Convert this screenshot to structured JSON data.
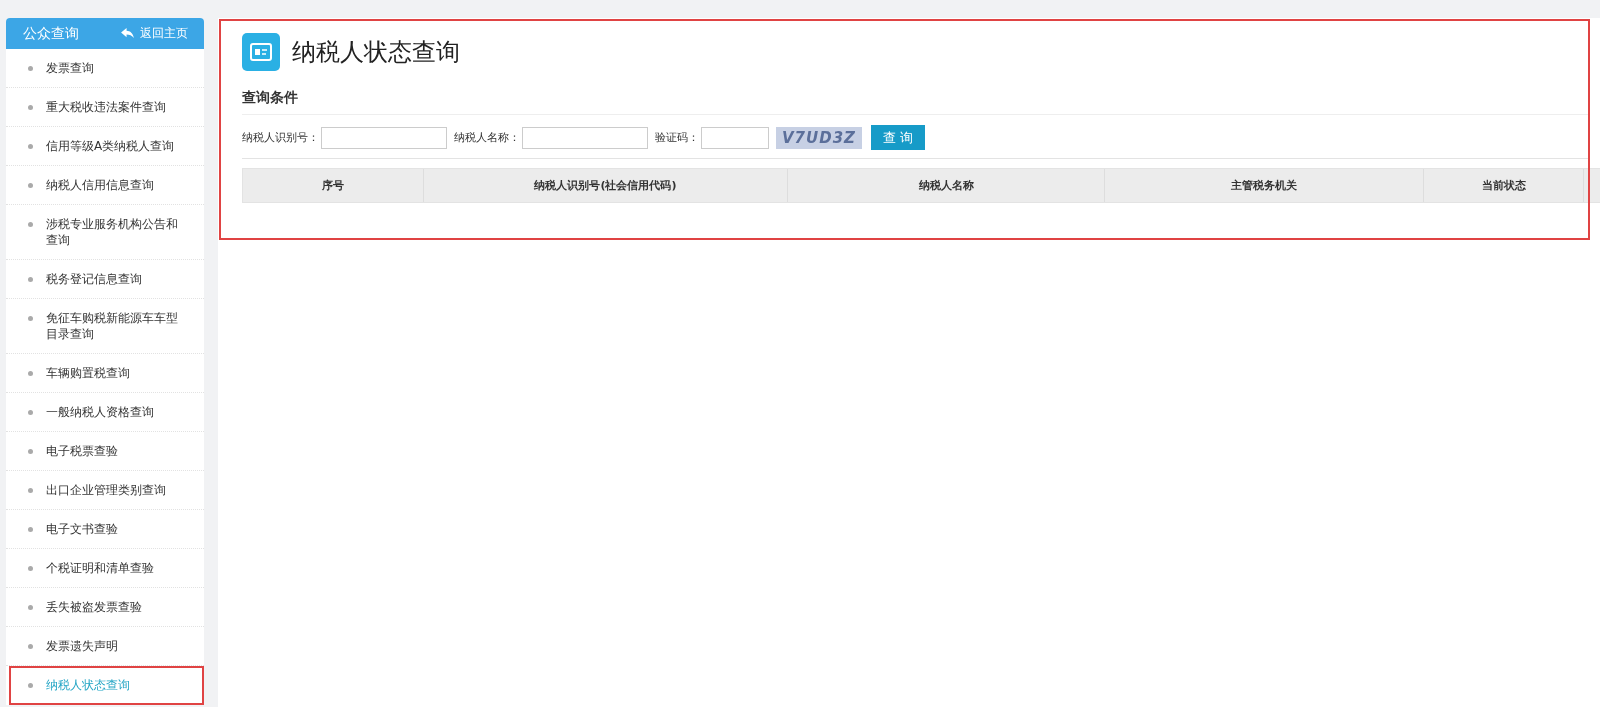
{
  "sidebar": {
    "title": "公众查询",
    "back_link": "返回主页",
    "items": [
      {
        "label": "发票查询",
        "selected": false,
        "annotated": false
      },
      {
        "label": "重大税收违法案件查询",
        "selected": false,
        "annotated": false
      },
      {
        "label": "信用等级A类纳税人查询",
        "selected": false,
        "annotated": false
      },
      {
        "label": "纳税人信用信息查询",
        "selected": false,
        "annotated": false
      },
      {
        "label": "涉税专业服务机构公告和查询",
        "selected": false,
        "annotated": false
      },
      {
        "label": "税务登记信息查询",
        "selected": false,
        "annotated": false
      },
      {
        "label": "免征车购税新能源车车型目录查询",
        "selected": false,
        "annotated": false
      },
      {
        "label": "车辆购置税查询",
        "selected": false,
        "annotated": false
      },
      {
        "label": "一般纳税人资格查询",
        "selected": false,
        "annotated": false
      },
      {
        "label": "电子税票查验",
        "selected": false,
        "annotated": false
      },
      {
        "label": "出口企业管理类别查询",
        "selected": false,
        "annotated": false
      },
      {
        "label": "电子文书查验",
        "selected": false,
        "annotated": false
      },
      {
        "label": "个税证明和清单查验",
        "selected": false,
        "annotated": false
      },
      {
        "label": "丢失被盗发票查验",
        "selected": false,
        "annotated": false
      },
      {
        "label": "发票遗失声明",
        "selected": false,
        "annotated": false
      },
      {
        "label": "纳税人状态查询",
        "selected": true,
        "annotated": true
      }
    ]
  },
  "main": {
    "annotated": true,
    "title": "纳税人状态查询",
    "section": "查询条件",
    "fields": [
      {
        "kind": "text",
        "label": "纳税人识别号："
      },
      {
        "kind": "text",
        "label": "纳税人名称："
      },
      {
        "kind": "captcha",
        "label": "验证码：",
        "captcha": "V7UD3Z"
      }
    ],
    "search_button": "查 询",
    "table": {
      "columns": [
        "序号",
        "纳税人识别号(社会信用代码)",
        "纳税人名称",
        "主管税务机关",
        "当前状态"
      ]
    }
  }
}
